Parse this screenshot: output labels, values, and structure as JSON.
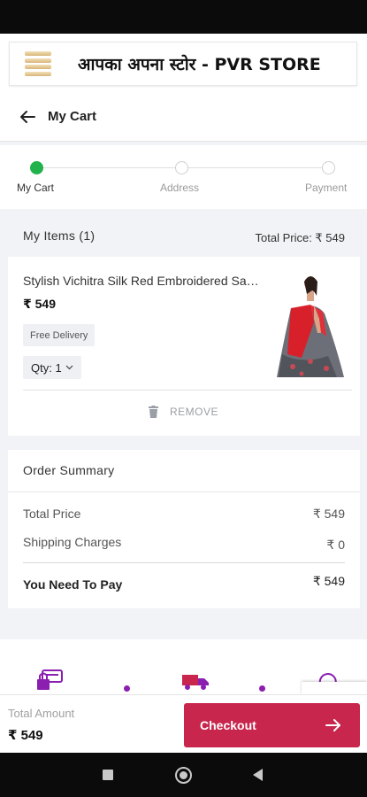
{
  "store": {
    "name": "आपका अपना स्टोर - PVR STORE",
    "logo_icon": "store-logo-icon"
  },
  "header": {
    "title": "My Cart",
    "back_icon": "back-arrow-icon"
  },
  "steps": [
    {
      "label": "My Cart",
      "active": true
    },
    {
      "label": "Address",
      "active": false
    },
    {
      "label": "Payment",
      "active": false
    }
  ],
  "items_section": {
    "title": "My Items (1)",
    "total": "Total Price: ₹ 549"
  },
  "item": {
    "name": "Stylish Vichitra Silk Red Embroidered Saree",
    "price": "₹ 549",
    "badge": "Free Delivery",
    "qty": "Qty: 1",
    "remove": "REMOVE"
  },
  "summary": {
    "title": "Order Summary",
    "rows": [
      {
        "label": "Total Price",
        "value": "₹ 549"
      },
      {
        "label": "Shipping Charges",
        "value": "₹ 0"
      }
    ],
    "pay_label": "You Need To Pay",
    "pay_value": "₹ 549"
  },
  "bottom": {
    "total_label": "Total Amount",
    "total_value": "₹ 549",
    "checkout": "Checkout"
  },
  "colors": {
    "accent": "#c8264d",
    "step_active": "#21b24b",
    "trust_icon": "#8a1fb0"
  }
}
